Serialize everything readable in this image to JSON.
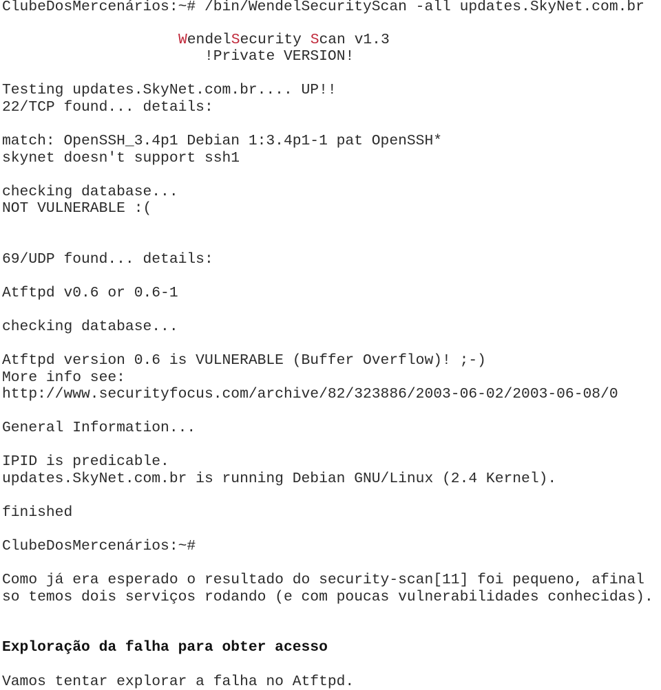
{
  "accent_color": "#c0283a",
  "terminal": {
    "command_prompt": "ClubeDosMercenários:~# /bin/WendelSecurityScan -all updates.SkyNet.com.br",
    "banner": {
      "title_parts": [
        {
          "text": "W",
          "red": true
        },
        {
          "text": "endel",
          "red": false
        },
        {
          "text": "S",
          "red": true
        },
        {
          "text": "ecurity ",
          "red": false
        },
        {
          "text": "S",
          "red": true
        },
        {
          "text": "can v1.3",
          "red": false
        }
      ],
      "subtitle": "!Private VERSION!"
    },
    "lines": {
      "testing": "Testing updates.SkyNet.com.br.... UP!!",
      "tcp_found": "22/TCP found... details:",
      "match": "match: OpenSSH_3.4p1 Debian 1:3.4p1-1 pat OpenSSH*",
      "ssh1": "skynet doesn't support ssh1",
      "checking1": "checking database...",
      "not_vulnerable": "NOT VULNERABLE :(",
      "udp_found": "69/UDP found... details:",
      "atftpd_version": "Atftpd v0.6 or 0.6-1",
      "checking2": "checking database...",
      "vulnerable": "Atftpd version 0.6 is VULNERABLE (Buffer Overflow)! ;-)",
      "more_info": "More info see:",
      "url": "http://www.securityfocus.com/archive/82/323886/2003-06-02/2003-06-08/0",
      "general_info": "General Information...",
      "ipid": "IPID is predicable.",
      "os": "updates.SkyNet.com.br is running Debian GNU/Linux (2.4 Kernel).",
      "finished": "finished",
      "final_prompt": "ClubeDosMercenários:~#"
    }
  },
  "document": {
    "paragraph_line1": "Como já era esperado o resultado do security-scan[11] foi pequeno, afinal",
    "paragraph_line2": "so temos dois serviços rodando (e com poucas vulnerabilidades conhecidas).",
    "heading": "Exploração da falha para obter acesso",
    "closing": "Vamos tentar explorar a falha no Atftpd."
  }
}
